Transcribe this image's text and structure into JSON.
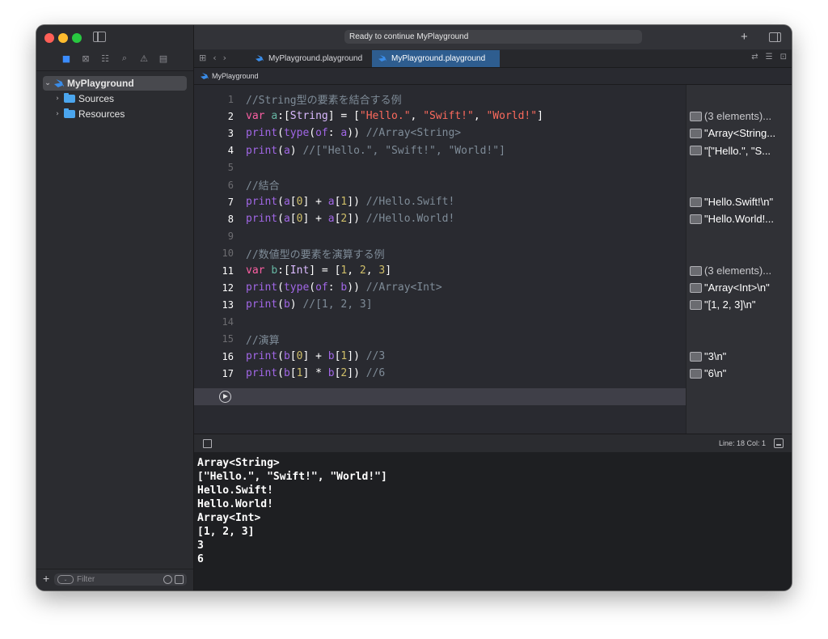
{
  "status": "Ready to continue MyPlayground",
  "tabs": [
    "MyPlayground.playground",
    "MyPlayground.playground"
  ],
  "jumpbar": "MyPlayground",
  "navigator": {
    "items": [
      {
        "label": "MyPlayground",
        "icon": "swift-icon",
        "selected": true
      },
      {
        "label": "Sources",
        "icon": "folder-icon"
      },
      {
        "label": "Resources",
        "icon": "folder-icon"
      }
    ],
    "filter_placeholder": "Filter"
  },
  "editor": {
    "lines": [
      {
        "n": "1",
        "tokens": [
          {
            "t": "//String型の要素を結合する例",
            "c": "cm"
          }
        ]
      },
      {
        "n": "2",
        "tokens": [
          {
            "t": "var",
            "c": "kw"
          },
          {
            "t": " ",
            "c": "pl"
          },
          {
            "t": "a",
            "c": "id"
          },
          {
            "t": ":[",
            "c": "pl"
          },
          {
            "t": "String",
            "c": "ty"
          },
          {
            "t": "] = [",
            "c": "pl"
          },
          {
            "t": "\"Hello.\"",
            "c": "str"
          },
          {
            "t": ", ",
            "c": "pl"
          },
          {
            "t": "\"Swift!\"",
            "c": "str"
          },
          {
            "t": ", ",
            "c": "pl"
          },
          {
            "t": "\"World!\"",
            "c": "str"
          },
          {
            "t": "]",
            "c": "pl"
          }
        ]
      },
      {
        "n": "3",
        "tokens": [
          {
            "t": "print",
            "c": "fn"
          },
          {
            "t": "(",
            "c": "pl"
          },
          {
            "t": "type",
            "c": "fn"
          },
          {
            "t": "(",
            "c": "pl"
          },
          {
            "t": "of",
            "c": "fn"
          },
          {
            "t": ": ",
            "c": "pl"
          },
          {
            "t": "a",
            "c": "fn"
          },
          {
            "t": ")) ",
            "c": "pl"
          },
          {
            "t": "//Array<String>",
            "c": "cm"
          }
        ]
      },
      {
        "n": "4",
        "tokens": [
          {
            "t": "print",
            "c": "fn"
          },
          {
            "t": "(",
            "c": "pl"
          },
          {
            "t": "a",
            "c": "fn"
          },
          {
            "t": ") ",
            "c": "pl"
          },
          {
            "t": "//[\"Hello.\", \"Swift!\", \"World!\"]",
            "c": "cm"
          }
        ]
      },
      {
        "n": "5",
        "tokens": []
      },
      {
        "n": "6",
        "tokens": [
          {
            "t": "//結合",
            "c": "cm"
          }
        ]
      },
      {
        "n": "7",
        "tokens": [
          {
            "t": "print",
            "c": "fn"
          },
          {
            "t": "(",
            "c": "pl"
          },
          {
            "t": "a",
            "c": "fn"
          },
          {
            "t": "[",
            "c": "pl"
          },
          {
            "t": "0",
            "c": "num"
          },
          {
            "t": "] + ",
            "c": "pl"
          },
          {
            "t": "a",
            "c": "fn"
          },
          {
            "t": "[",
            "c": "pl"
          },
          {
            "t": "1",
            "c": "num"
          },
          {
            "t": "]) ",
            "c": "pl"
          },
          {
            "t": "//Hello.Swift!",
            "c": "cm"
          }
        ]
      },
      {
        "n": "8",
        "tokens": [
          {
            "t": "print",
            "c": "fn"
          },
          {
            "t": "(",
            "c": "pl"
          },
          {
            "t": "a",
            "c": "fn"
          },
          {
            "t": "[",
            "c": "pl"
          },
          {
            "t": "0",
            "c": "num"
          },
          {
            "t": "] + ",
            "c": "pl"
          },
          {
            "t": "a",
            "c": "fn"
          },
          {
            "t": "[",
            "c": "pl"
          },
          {
            "t": "2",
            "c": "num"
          },
          {
            "t": "]) ",
            "c": "pl"
          },
          {
            "t": "//Hello.World!",
            "c": "cm"
          }
        ]
      },
      {
        "n": "9",
        "tokens": []
      },
      {
        "n": "10",
        "tokens": [
          {
            "t": "//数値型の要素を演算する例",
            "c": "cm"
          }
        ]
      },
      {
        "n": "11",
        "tokens": [
          {
            "t": "var",
            "c": "kw"
          },
          {
            "t": " ",
            "c": "pl"
          },
          {
            "t": "b",
            "c": "id"
          },
          {
            "t": ":[",
            "c": "pl"
          },
          {
            "t": "Int",
            "c": "ty"
          },
          {
            "t": "] = [",
            "c": "pl"
          },
          {
            "t": "1",
            "c": "num"
          },
          {
            "t": ", ",
            "c": "pl"
          },
          {
            "t": "2",
            "c": "num"
          },
          {
            "t": ", ",
            "c": "pl"
          },
          {
            "t": "3",
            "c": "num"
          },
          {
            "t": "]",
            "c": "pl"
          }
        ]
      },
      {
        "n": "12",
        "tokens": [
          {
            "t": "print",
            "c": "fn"
          },
          {
            "t": "(",
            "c": "pl"
          },
          {
            "t": "type",
            "c": "fn"
          },
          {
            "t": "(",
            "c": "pl"
          },
          {
            "t": "of",
            "c": "fn"
          },
          {
            "t": ": ",
            "c": "pl"
          },
          {
            "t": "b",
            "c": "fn"
          },
          {
            "t": ")) ",
            "c": "pl"
          },
          {
            "t": "//Array<Int>",
            "c": "cm"
          }
        ]
      },
      {
        "n": "13",
        "tokens": [
          {
            "t": "print",
            "c": "fn"
          },
          {
            "t": "(",
            "c": "pl"
          },
          {
            "t": "b",
            "c": "fn"
          },
          {
            "t": ") ",
            "c": "pl"
          },
          {
            "t": "//[1, 2, 3]",
            "c": "cm"
          }
        ]
      },
      {
        "n": "14",
        "tokens": []
      },
      {
        "n": "15",
        "tokens": [
          {
            "t": "//演算",
            "c": "cm"
          }
        ]
      },
      {
        "n": "16",
        "tokens": [
          {
            "t": "print",
            "c": "fn"
          },
          {
            "t": "(",
            "c": "pl"
          },
          {
            "t": "b",
            "c": "fn"
          },
          {
            "t": "[",
            "c": "pl"
          },
          {
            "t": "0",
            "c": "num"
          },
          {
            "t": "] + ",
            "c": "pl"
          },
          {
            "t": "b",
            "c": "fn"
          },
          {
            "t": "[",
            "c": "pl"
          },
          {
            "t": "1",
            "c": "num"
          },
          {
            "t": "]) ",
            "c": "pl"
          },
          {
            "t": "//3",
            "c": "cm"
          }
        ]
      },
      {
        "n": "17",
        "tokens": [
          {
            "t": "print",
            "c": "fn"
          },
          {
            "t": "(",
            "c": "pl"
          },
          {
            "t": "b",
            "c": "fn"
          },
          {
            "t": "[",
            "c": "pl"
          },
          {
            "t": "1",
            "c": "num"
          },
          {
            "t": "] * ",
            "c": "pl"
          },
          {
            "t": "b",
            "c": "fn"
          },
          {
            "t": "[",
            "c": "pl"
          },
          {
            "t": "2",
            "c": "num"
          },
          {
            "t": "]) ",
            "c": "pl"
          },
          {
            "t": "//6",
            "c": "cm"
          }
        ]
      }
    ]
  },
  "results": [
    {
      "line": 2,
      "text": "(3 elements)...",
      "dim": true
    },
    {
      "line": 3,
      "text": "\"Array<String..."
    },
    {
      "line": 4,
      "text": "\"[\"Hello.\", \"S..."
    },
    {
      "line": 7,
      "text": "\"Hello.Swift!\\n\""
    },
    {
      "line": 8,
      "text": "\"Hello.World!..."
    },
    {
      "line": 11,
      "text": "(3 elements)...",
      "dim": true
    },
    {
      "line": 12,
      "text": "\"Array<Int>\\n\""
    },
    {
      "line": 13,
      "text": "\"[1, 2, 3]\\n\""
    },
    {
      "line": 16,
      "text": "\"3\\n\""
    },
    {
      "line": 17,
      "text": "\"6\\n\""
    }
  ],
  "debug_status": "Line: 18  Col: 1",
  "console": [
    "Array<String>",
    "[\"Hello.\", \"Swift!\", \"World!\"]",
    "Hello.Swift!",
    "Hello.World!",
    "Array<Int>",
    "[1, 2, 3]",
    "3",
    "6"
  ]
}
